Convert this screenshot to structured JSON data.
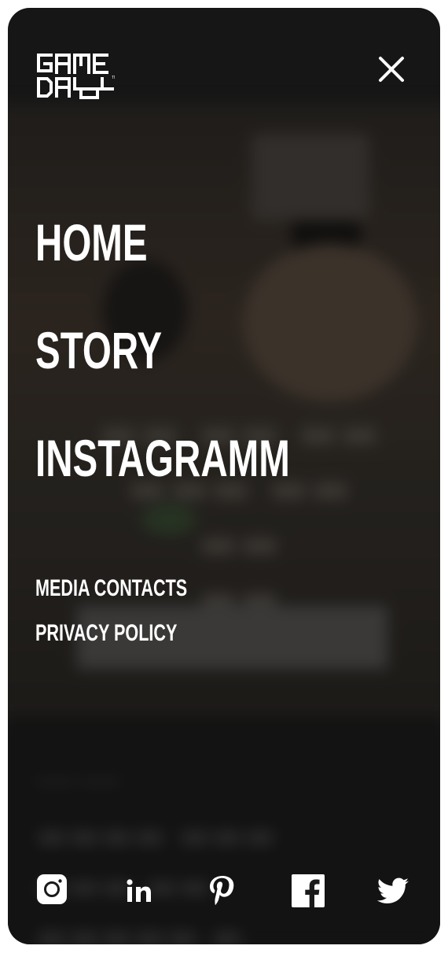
{
  "brand": {
    "logo_line_1": "GAME",
    "logo_line_2": "DAY"
  },
  "menu": {
    "close_icon": "close-icon",
    "primary": [
      {
        "label": "HOME"
      },
      {
        "label": "STORY"
      },
      {
        "label": "INSTAGRAMM"
      }
    ],
    "secondary": [
      {
        "label": "MEDIA CONTACTS"
      },
      {
        "label": "PRIVACY POLICY"
      }
    ]
  },
  "social": [
    {
      "icon": "instagram-icon"
    },
    {
      "icon": "linkedin-icon"
    },
    {
      "icon": "pinterest-icon"
    },
    {
      "icon": "facebook-icon"
    },
    {
      "icon": "twitter-icon"
    }
  ],
  "colors": {
    "overlay": "#121212",
    "text": "#ffffff"
  }
}
